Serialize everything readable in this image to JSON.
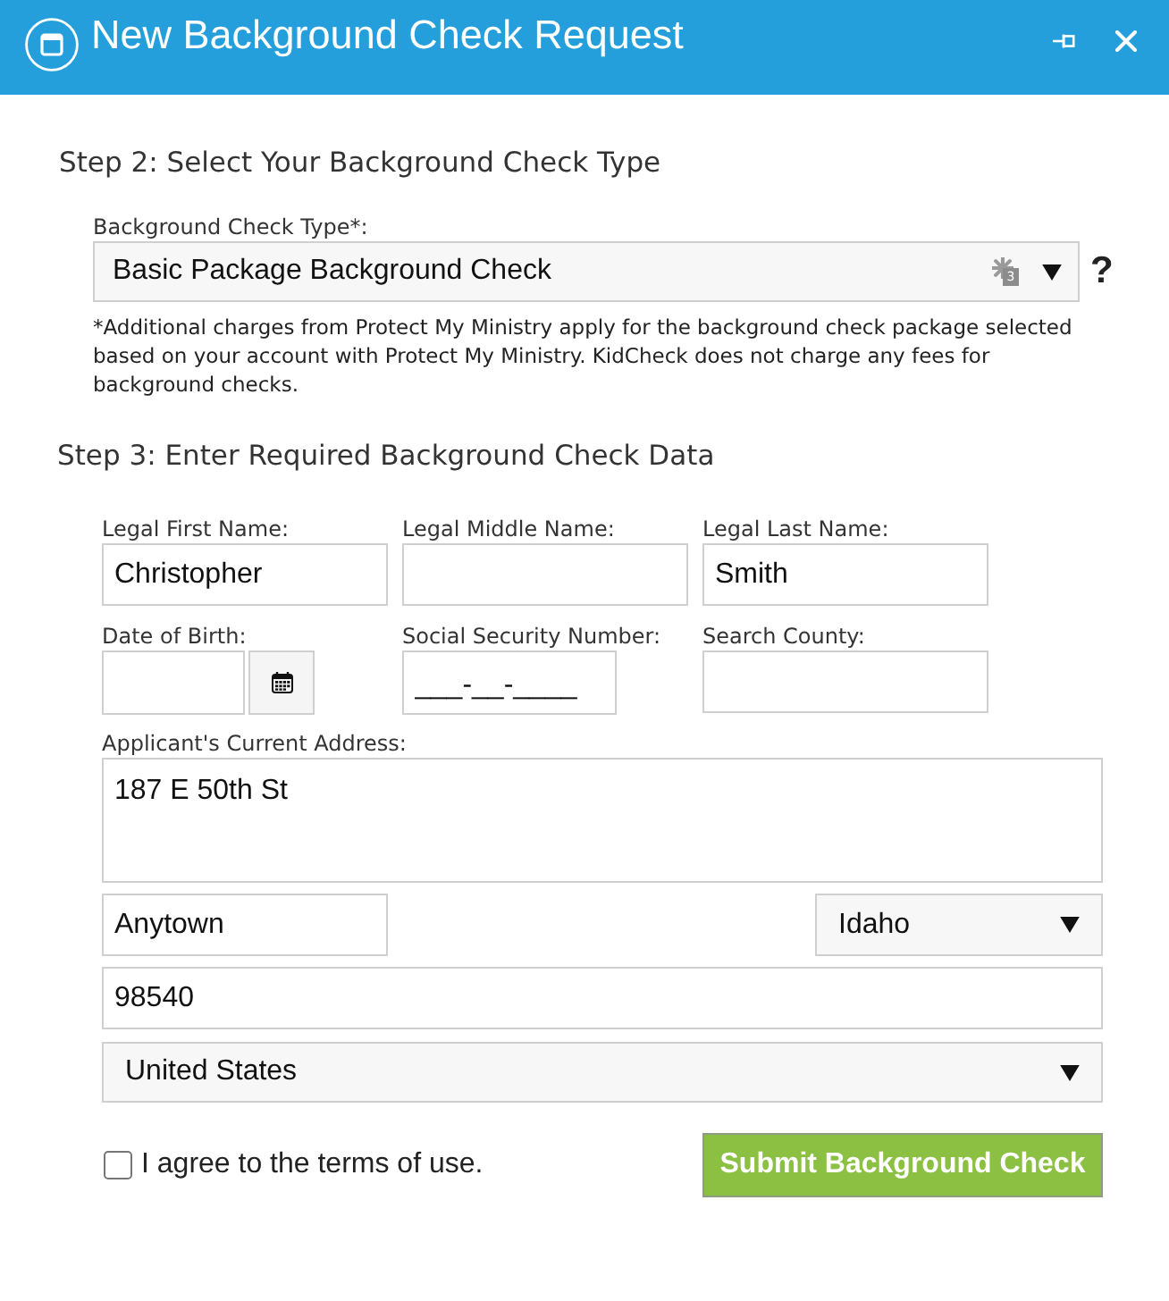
{
  "window": {
    "title": "New Background Check Request"
  },
  "step_2": {
    "heading": "Step 2: Select Your Background Check Type",
    "check_type": {
      "label": "Background Check Type*:",
      "value": "Basic Package Background Check",
      "badge": "3"
    },
    "help": "?",
    "note": "*Additional charges from Protect My Ministry apply for the background check package selected based on your account with Protect My Ministry. KidCheck does not charge any fees for background checks."
  },
  "step_3": {
    "heading": "Step 3: Enter Required Background Check Data",
    "fields": [
      {
        "kind": "text",
        "label": "Legal First Name:",
        "value": "Christopher"
      },
      {
        "kind": "text",
        "label": "Legal Middle Name:"
      },
      {
        "kind": "text",
        "label": "Legal Last Name:",
        "value": "Smith"
      },
      {
        "kind": "date",
        "label": "Date of Birth:"
      },
      {
        "kind": "masked",
        "label": "Social Security Number:",
        "value": "___-__-____"
      },
      {
        "kind": "text",
        "label": "Search County:"
      }
    ],
    "address": {
      "label": "Applicant's Current Address:",
      "street": "187 E 50th St",
      "city": "Anytown",
      "state": "Idaho",
      "zip": "98540",
      "country": "United States"
    }
  },
  "terms": {
    "label": "I agree to the terms of use.",
    "checked": false
  },
  "submit_button": "Submit Background Check"
}
